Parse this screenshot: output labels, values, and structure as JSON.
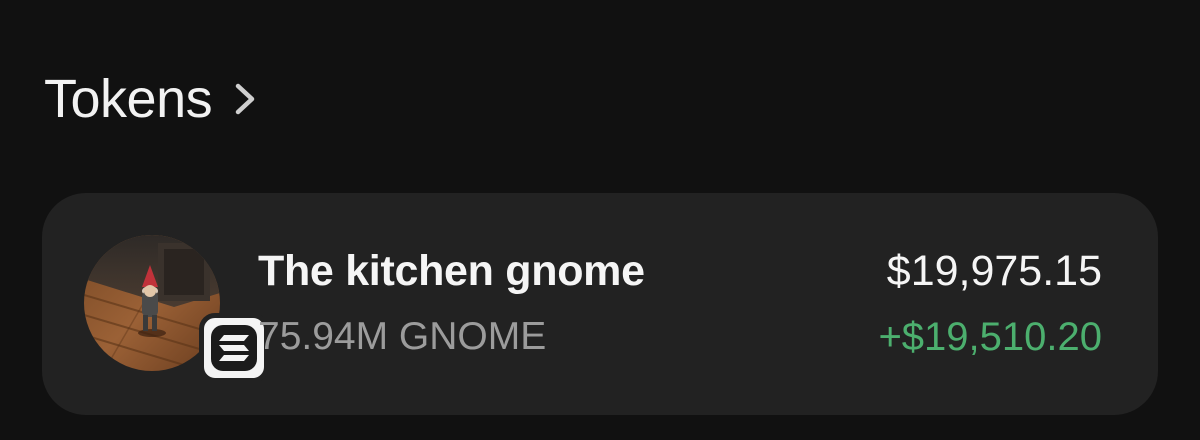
{
  "section": {
    "title": "Tokens",
    "chevron_icon": "chevron-right-icon"
  },
  "token": {
    "name": "The kitchen gnome",
    "amount": "75.94M GNOME",
    "value": "$19,975.15",
    "change": "+$19,510.20",
    "avatar_icon": "gnome-avatar",
    "chain_badge_icon": "solana-icon"
  },
  "colors": {
    "background": "#111111",
    "card": "#222222",
    "primary_text": "#f5f5f5",
    "secondary_text": "#9c9c9c",
    "positive": "#4caf6e"
  }
}
